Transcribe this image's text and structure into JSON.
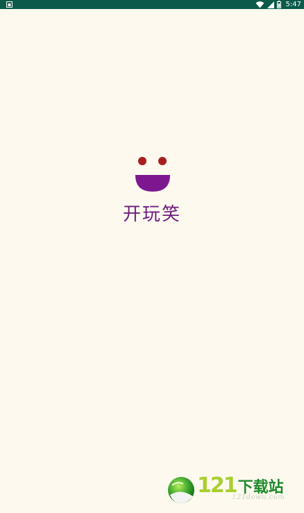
{
  "status_bar": {
    "time": "5:47",
    "notification_icon": "notification-icon",
    "wifi_icon": "wifi-icon",
    "signal_icon": "signal-icon",
    "battery_icon": "battery-icon",
    "background_color": "#0b5a4a"
  },
  "splash": {
    "app_name": "开玩笑",
    "app_name_color": "#6d1d7d",
    "logo_icon": "smiley-icon",
    "eye_color": "#a81e1e",
    "mouth_color": "#7d1790",
    "background_color": "#fdf9ef"
  },
  "watermark": {
    "number": "121",
    "chinese": "下载站",
    "domain": "121dowu.com",
    "logo_icon": "globe-logo-icon"
  }
}
